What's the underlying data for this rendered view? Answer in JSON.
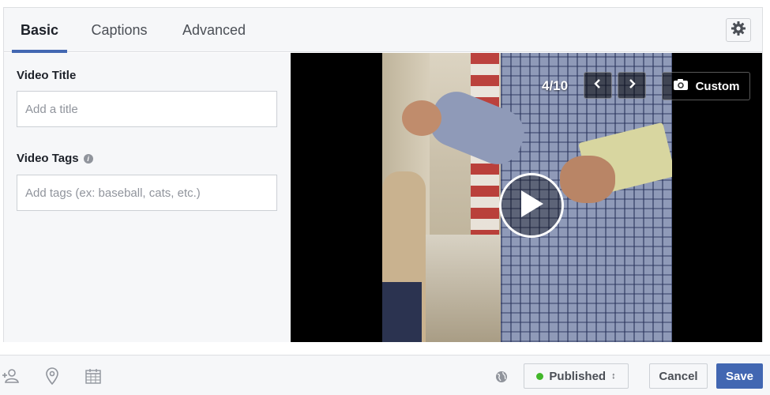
{
  "tabs": [
    {
      "label": "Basic",
      "active": true
    },
    {
      "label": "Captions",
      "active": false
    },
    {
      "label": "Advanced",
      "active": false
    }
  ],
  "settings": {
    "icon": "gear-icon"
  },
  "basic": {
    "video_title_label": "Video Title",
    "video_title_placeholder": "Add a title",
    "video_title_value": "",
    "video_tags_label": "Video Tags",
    "video_tags_info_icon": "info-icon",
    "video_tags_placeholder": "Add tags (ex: baseball, cats, etc.)",
    "video_tags_value": ""
  },
  "video": {
    "thumbnail_counter": "4/10",
    "prev_icon": "chevron-left-icon",
    "next_icon": "chevron-right-icon",
    "custom_label": "Custom",
    "custom_icon": "camera-icon",
    "play_icon": "play-icon"
  },
  "footer": {
    "icons": [
      "tag-people-icon",
      "location-icon",
      "calendar-icon",
      "globe-icon"
    ],
    "status_label": "Published",
    "status_color": "#42b72a",
    "cancel_label": "Cancel",
    "save_label": "Save"
  },
  "colors": {
    "accent": "#4267b2",
    "panel_bg": "#f6f7f9",
    "border": "#dddfe2"
  }
}
